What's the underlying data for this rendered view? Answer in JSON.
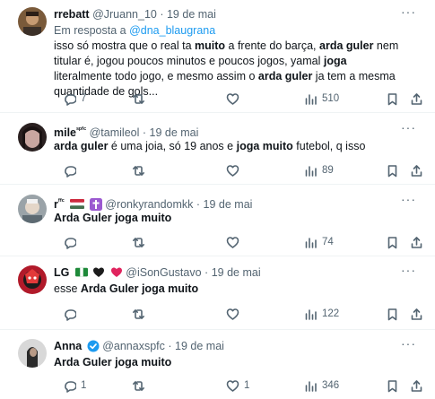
{
  "tweets": [
    {
      "name": "rrebatt",
      "handle": "@Jruann_10",
      "sep": "·",
      "date": "19 de mai",
      "reply_prefix": "Em resposta a",
      "reply_to": "@dna_blaugrana",
      "text": [
        [
          "isso só mostra que o real ta ",
          false
        ],
        [
          "muito",
          true
        ],
        [
          " a frente do barça, ",
          false
        ],
        [
          "arda guler",
          true
        ],
        [
          " nem titular é, jogou poucos minutos e poucos jogos, yamal ",
          false
        ],
        [
          "joga",
          true
        ],
        [
          " literalmente todo jogo, e mesmo assim o ",
          false
        ],
        [
          "arda guler",
          true
        ],
        [
          " ja tem a mesma quantidade de gols...",
          false
        ]
      ],
      "replies": "7",
      "retweets": "",
      "likes": "",
      "views": "510"
    },
    {
      "name": "mile",
      "name_suffix": "ˢᵖᶠᶜ",
      "handle": "@tamileol",
      "sep": "·",
      "date": "19 de mai",
      "text": [
        [
          "arda guler",
          true
        ],
        [
          " é uma joia, só 19 anos e ",
          false
        ],
        [
          "joga muito",
          true
        ],
        [
          " futebol, q isso",
          false
        ]
      ],
      "replies": "",
      "retweets": "",
      "likes": "",
      "views": "89"
    },
    {
      "name": "r",
      "name_suffix": "ᶠᶠᶜ",
      "handle": "@ronkyrandomkk",
      "sep": "·",
      "date": "19 de mai",
      "text": [
        [
          "Arda Guler joga muito",
          true
        ]
      ],
      "replies": "",
      "retweets": "",
      "likes": "",
      "views": "74"
    },
    {
      "name": "LG",
      "handle": "@iSonGustavo",
      "sep": "·",
      "date": "19 de mai",
      "text": [
        [
          "esse ",
          false
        ],
        [
          "Arda Guler joga muito",
          true
        ]
      ],
      "replies": "",
      "retweets": "",
      "likes": "",
      "views": "122"
    },
    {
      "name": "Anna",
      "handle": "@annaxspfc",
      "sep": "·",
      "date": "19 de mai",
      "text": [
        [
          "Arda Guler joga muito",
          true
        ]
      ],
      "replies": "1",
      "retweets": "",
      "likes": "1",
      "views": "346"
    }
  ],
  "colors": {
    "accent": "#1d9bf0",
    "muted": "#536471",
    "verified": "#1d9bf0"
  },
  "icons": {
    "reply": "reply-icon",
    "retweet": "retweet-icon",
    "like": "heart-icon",
    "views": "views-icon",
    "bookmark": "bookmark-icon",
    "share": "share-icon",
    "more": "more-icon"
  }
}
